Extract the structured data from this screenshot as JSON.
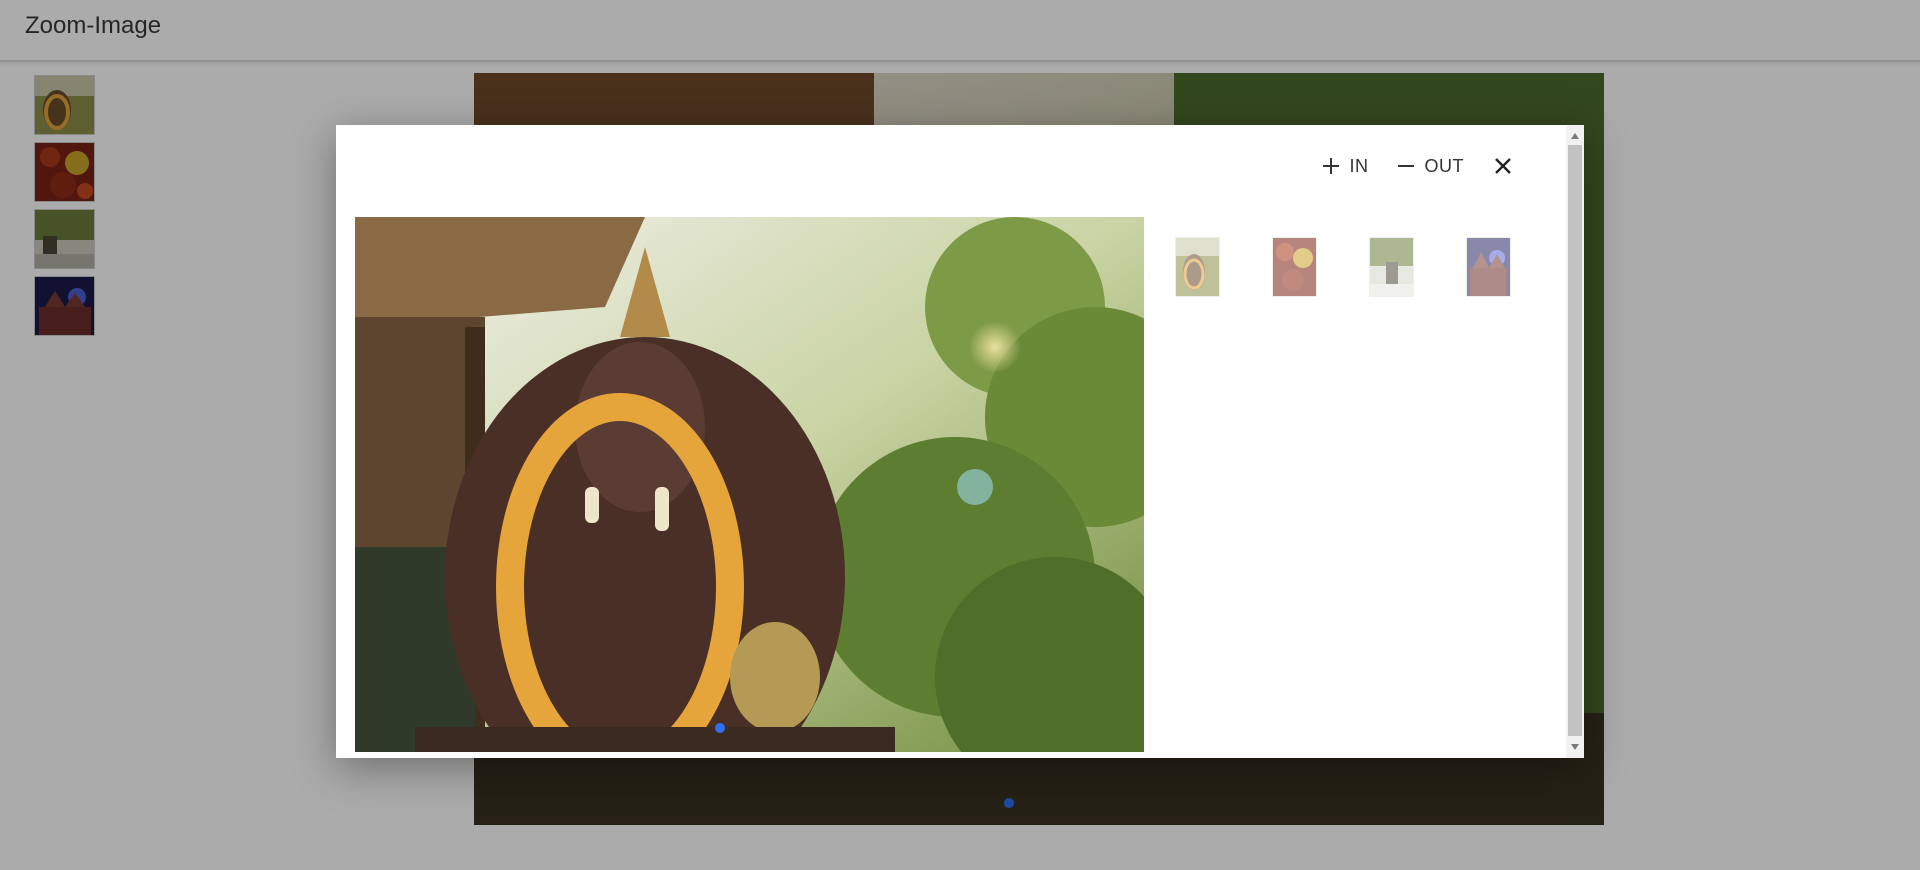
{
  "app": {
    "title": "Zoom-Image"
  },
  "toolbar": {
    "zoom_in_label": "IN",
    "zoom_out_label": "OUT"
  },
  "icons": {
    "zoom_in": "plus-icon",
    "zoom_out": "minus-icon",
    "close": "close-icon"
  },
  "thumbnails": [
    {
      "name": "ganesha-statue"
    },
    {
      "name": "red-autumn-leaves"
    },
    {
      "name": "forest-path"
    },
    {
      "name": "night-temple"
    }
  ],
  "colors": {
    "accent_dot": "#2f6ff0",
    "overlay": "rgba(0,0,0,0.33)"
  }
}
